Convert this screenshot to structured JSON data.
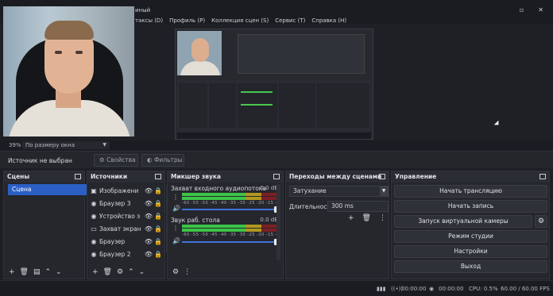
{
  "window": {
    "title_fragment": "иный",
    "menus": [
      "таксы (D)",
      "Профиль (P)",
      "Коллекция сцен (S)",
      "Сервис (T)",
      "Справка (H)"
    ],
    "controls": [
      "▫",
      "✕"
    ]
  },
  "zoom": {
    "percent": "39%",
    "mode": "По размеру окна"
  },
  "context_bar": {
    "selection_label": "Источник не выбран",
    "properties_label": "Свойства",
    "filters_label": "Фильтры"
  },
  "scenes": {
    "title": "Сцены",
    "items": [
      "Сцена"
    ]
  },
  "sources": {
    "title": "Источники",
    "items": [
      {
        "name": "Изображени",
        "icon": "image-icon"
      },
      {
        "name": "Браузер 3",
        "icon": "browser-icon"
      },
      {
        "name": "Устройство з",
        "icon": "device-icon"
      },
      {
        "name": "Захват экран",
        "icon": "monitor-icon"
      },
      {
        "name": "Браузер",
        "icon": "browser-icon"
      },
      {
        "name": "Браузер 2",
        "icon": "browser-icon"
      }
    ]
  },
  "mixer": {
    "title": "Микшер звука",
    "tick_labels": "-60 -55 -50 -45 -40 -35 -30 -25 -20 -15 -10 -5 0",
    "channels": [
      {
        "name": "Захват входного аудиопотока",
        "db": "0.0 dB",
        "volume": 1.0
      },
      {
        "name": "Звук раб. стола",
        "db": "0.0 dB",
        "volume": 1.0
      }
    ]
  },
  "transitions": {
    "title": "Переходы между сценами",
    "selected": "Затухание",
    "duration_label": "Длительность",
    "duration_value": "300 ms"
  },
  "controls": {
    "title": "Управление",
    "buttons": [
      "Начать трансляцию",
      "Начать запись",
      "Запуск виртуальной камеры",
      "Режим студии",
      "Настройки",
      "Выход"
    ]
  },
  "status": {
    "stream_time": "00:00:00",
    "record_time": "00:00:00",
    "cpu": "CPU: 0.5%",
    "fps": "60.00 / 60.00 FPS"
  },
  "colors": {
    "accent": "#2b5fc4",
    "meter_green": "#3cc447",
    "meter_yellow": "#b09820",
    "meter_red": "#7d1f24",
    "panel_bg": "#25272d"
  }
}
